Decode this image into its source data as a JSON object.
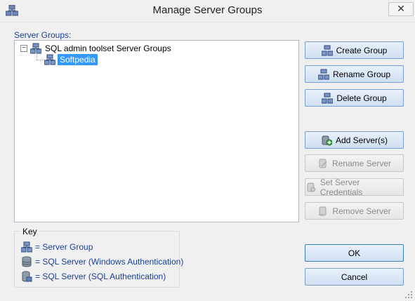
{
  "window": {
    "title": "Manage Server Groups",
    "close_glyph": "✕"
  },
  "tree": {
    "label": "Server Groups:",
    "root": {
      "label": "SQL admin toolset Server Groups",
      "expander": "−",
      "icon": "server-group-icon"
    },
    "child": {
      "label": "Softpedia",
      "selected": true,
      "icon": "server-group-icon"
    }
  },
  "buttons": {
    "create_group": "Create Group",
    "rename_group": "Rename Group",
    "delete_group": "Delete Group",
    "add_servers": "Add Server(s)",
    "rename_server": "Rename Server",
    "set_credentials": "Set Server Credentials",
    "remove_server": "Remove Server",
    "ok": "OK",
    "cancel": "Cancel"
  },
  "key": {
    "title": "Key",
    "items": [
      {
        "icon": "server-group-icon",
        "label": "= Server Group"
      },
      {
        "icon": "sql-server-windows-auth-icon",
        "label": "= SQL Server (Windows Authentication)"
      },
      {
        "icon": "sql-server-sql-auth-icon",
        "label": "= SQL Server (SQL Authentication)"
      }
    ]
  },
  "colors": {
    "selection": "#3399ff",
    "label_blue": "#1a3f96",
    "button_border": "#7aa0cf"
  }
}
